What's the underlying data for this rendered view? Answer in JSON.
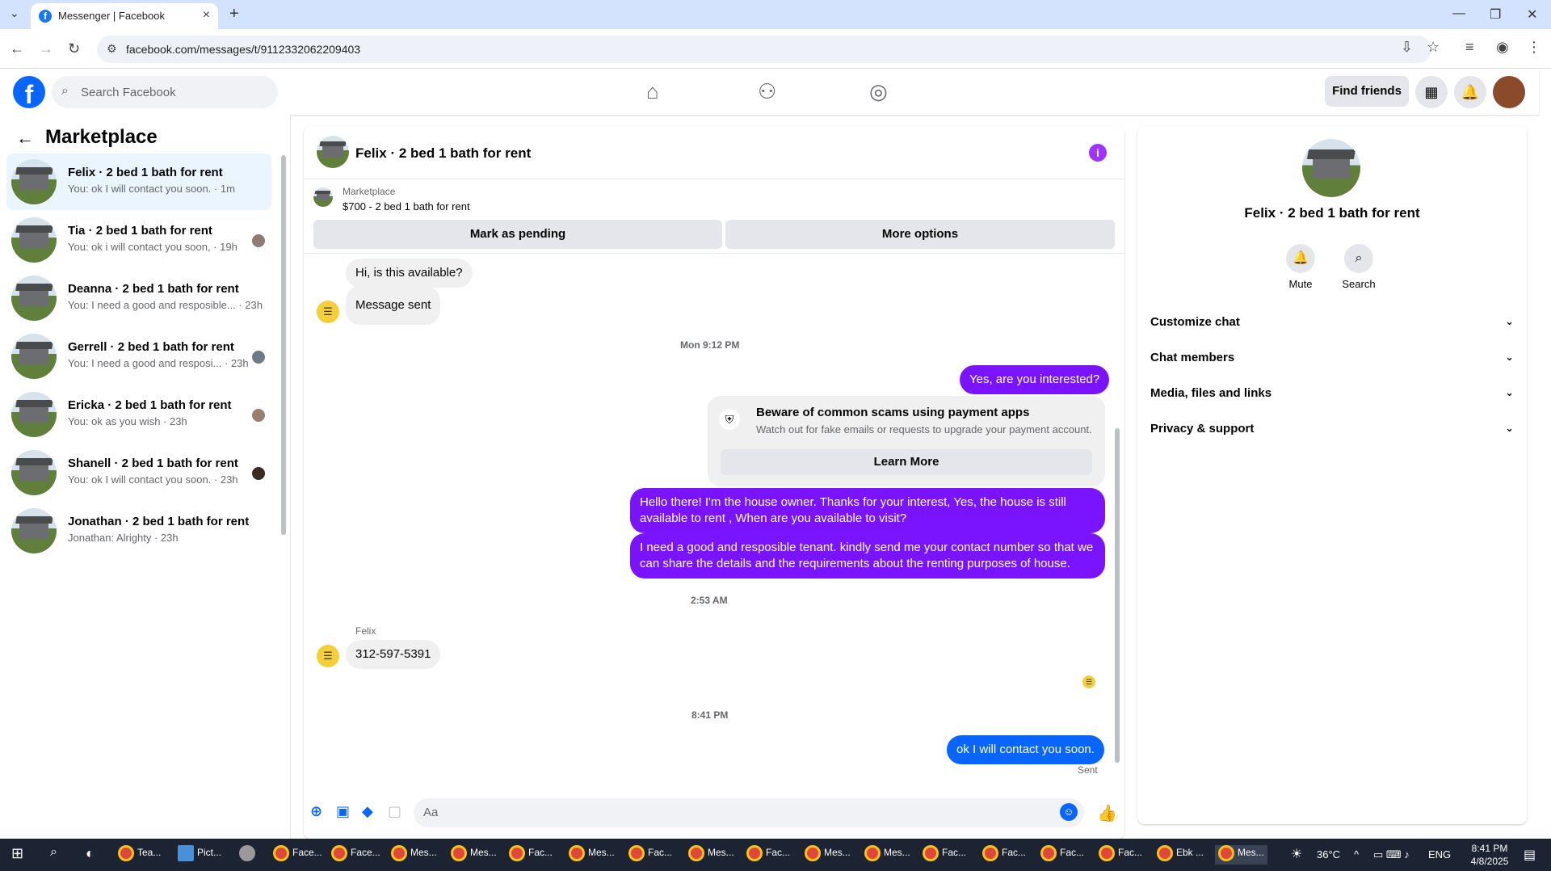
{
  "browser": {
    "tab_title": "Messenger | Facebook",
    "url": "facebook.com/messages/t/9112332062209403"
  },
  "header": {
    "search_placeholder": "Search Facebook",
    "find_friends": "Find friends"
  },
  "sidebar": {
    "title": "Marketplace",
    "conversations": [
      {
        "name": "Felix · 2 bed 1 bath for rent",
        "preview": "You: ok I will contact you soon. · 1m",
        "selected": true
      },
      {
        "name": "Tia · 2 bed 1 bath for rent",
        "preview": "You: ok i will contact you soon, · 19h"
      },
      {
        "name": "Deanna · 2 bed 1 bath for rent",
        "preview": "You: I need a good and resposible... · 23h"
      },
      {
        "name": "Gerrell · 2 bed 1 bath for rent",
        "preview": "You: I need a good and resposi... · 23h"
      },
      {
        "name": "Ericka · 2 bed 1 bath for rent",
        "preview": "You: ok as you wish · 23h"
      },
      {
        "name": "Shanell · 2 bed 1 bath for rent",
        "preview": "You: ok I will contact you soon. · 23h"
      },
      {
        "name": "Jonathan · 2 bed 1 bath for rent",
        "preview": "Jonathan: Alrighty · 23h"
      }
    ]
  },
  "chat": {
    "title": "Felix · 2 bed 1 bath for rent",
    "listing_source": "Marketplace",
    "listing": "$700 - 2 bed 1 bath for rent",
    "mark_pending": "Mark as pending",
    "more_options": "More options",
    "messages": {
      "m1": "Hi, is this available?",
      "m2": "Message sent",
      "ts1": "Mon 9:12 PM",
      "m3": "Yes, are you interested?",
      "scam_title": "Beware of common scams using payment apps",
      "scam_body": "Watch out for fake emails or requests to upgrade your payment account.",
      "learn_more": "Learn More",
      "m4": "Hello there! I'm the house owner. Thanks for your interest, Yes, the house is still available to rent , When are you available to visit?",
      "m5": "I need a good and resposible tenant.  kindly send me your contact number so that we can share the details and the requirements about the renting purposes of house.",
      "ts2": "2:53 AM",
      "sender": "Felix",
      "m6": "312-597-5391",
      "ts3": "8:41 PM",
      "m7": "ok I will contact you soon.",
      "status": "Sent"
    },
    "composer_placeholder": "Aa"
  },
  "details": {
    "title": "Felix · 2 bed 1 bath for rent",
    "mute": "Mute",
    "search": "Search",
    "sections": [
      "Customize chat",
      "Chat members",
      "Media, files and links",
      "Privacy & support"
    ]
  },
  "taskbar": {
    "items": [
      "Tea...",
      "Pict...",
      "Face...",
      "Face...",
      "Mes...",
      "Mes...",
      "Fac...",
      "Mes...",
      "Fac...",
      "Mes...",
      "Fac...",
      "Mes...",
      "Mes...",
      "Fac...",
      "Fac...",
      "Fac...",
      "Fac...",
      "Ebk ...",
      "Mes..."
    ],
    "temperature": "36°C",
    "language": "ENG",
    "time": "8:41 PM",
    "date": "4/8/2025"
  }
}
